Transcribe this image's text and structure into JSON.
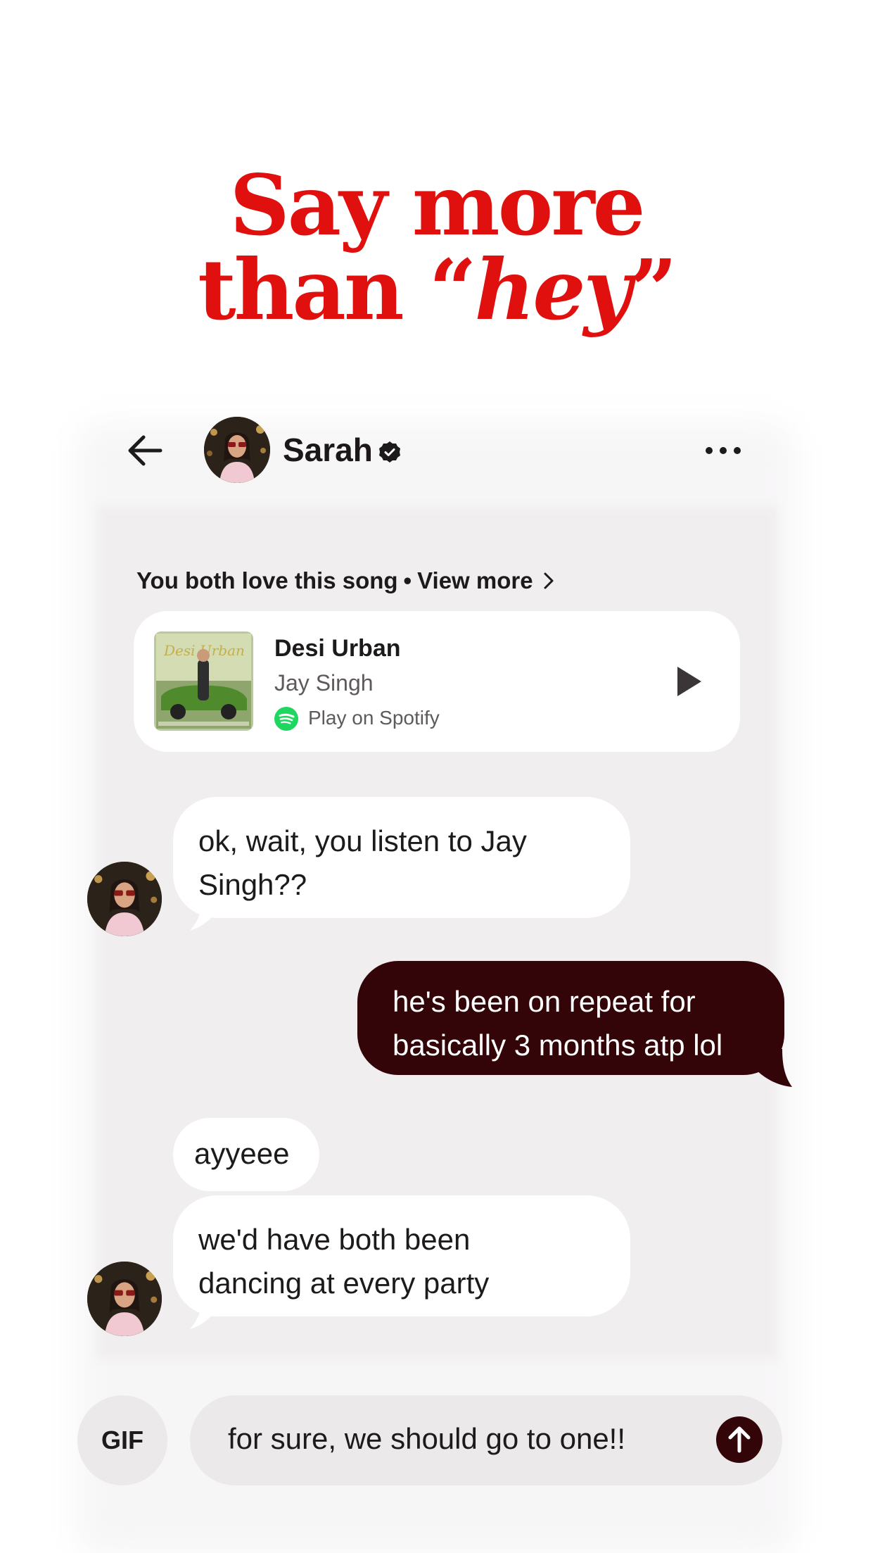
{
  "headline": {
    "line1": "Say more",
    "line2_prefix": "than “",
    "line2_emphasis": "hey",
    "line2_suffix": "”"
  },
  "header": {
    "name": "Sarah",
    "back_icon": "arrow-left-icon",
    "verified_icon": "verified-badge-icon",
    "more_icon": "more-horizontal-icon"
  },
  "shared_song": {
    "label": "You both love this song",
    "separator": "•",
    "view_more": "View more",
    "view_more_icon": "chevron-right-icon",
    "title": "Desi Urban",
    "artist": "Jay Singh",
    "play_on": "Play on Spotify",
    "album_art_text": "Desi Urban",
    "spotify_color": "#1ed760",
    "play_icon": "play-icon"
  },
  "messages": [
    {
      "sender": "Sarah",
      "direction": "incoming",
      "lines": [
        "ok, wait, you listen to Jay",
        "Singh??"
      ]
    },
    {
      "sender": "me",
      "direction": "outgoing",
      "lines": [
        "he's been on repeat for",
        "basically 3 months atp lol"
      ]
    },
    {
      "sender": "Sarah",
      "direction": "incoming",
      "lines": [
        "ayyeee"
      ]
    },
    {
      "sender": "Sarah",
      "direction": "incoming",
      "lines": [
        "we'd have both been",
        "dancing at every party"
      ]
    }
  ],
  "composer": {
    "gif_label": "GIF",
    "value": "for sure, we should go to one!!",
    "send_icon": "arrow-up-icon"
  },
  "colors": {
    "headline": "#e0100e",
    "outgoing_bubble": "#330508",
    "incoming_bubble": "#ffffff",
    "chat_background": "#f0eeef",
    "send_button": "#330508"
  }
}
